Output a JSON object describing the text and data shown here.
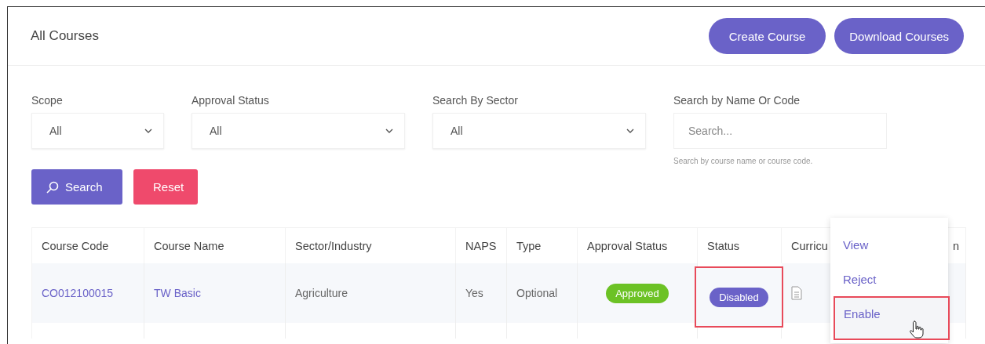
{
  "header": {
    "title": "All Courses",
    "buttons": [
      "Create Course",
      "Download Courses"
    ]
  },
  "filters": [
    {
      "kind": "select",
      "label": "Scope",
      "value": "All"
    },
    {
      "kind": "select",
      "label": "Approval Status",
      "value": "All"
    },
    {
      "kind": "select",
      "label": "Search By Sector",
      "value": "All"
    },
    {
      "kind": "text",
      "label": "Search by Name Or Code",
      "placeholder": "Search...",
      "help": "Search by course name or course code."
    }
  ],
  "actions": [
    {
      "kind": "search",
      "label": "Search"
    },
    {
      "kind": "reset",
      "label": "Reset"
    }
  ],
  "table": {
    "columns": [
      "Course Code",
      "Course Name",
      "Sector/Industry",
      "NAPS",
      "Type",
      "Approval Status",
      "Status",
      "Curricu",
      "n"
    ],
    "rows": [
      {
        "code": "CO012100015",
        "name": "TW Basic",
        "sector": "Agriculture",
        "naps": "Yes",
        "type": "Optional",
        "approval": "Approved",
        "status": "Disabled",
        "status_highlighted": true
      }
    ]
  },
  "menu": {
    "items": [
      {
        "label": "View",
        "highlighted": false
      },
      {
        "label": "Reject",
        "highlighted": false
      },
      {
        "label": "Enable",
        "highlighted": true
      }
    ]
  }
}
